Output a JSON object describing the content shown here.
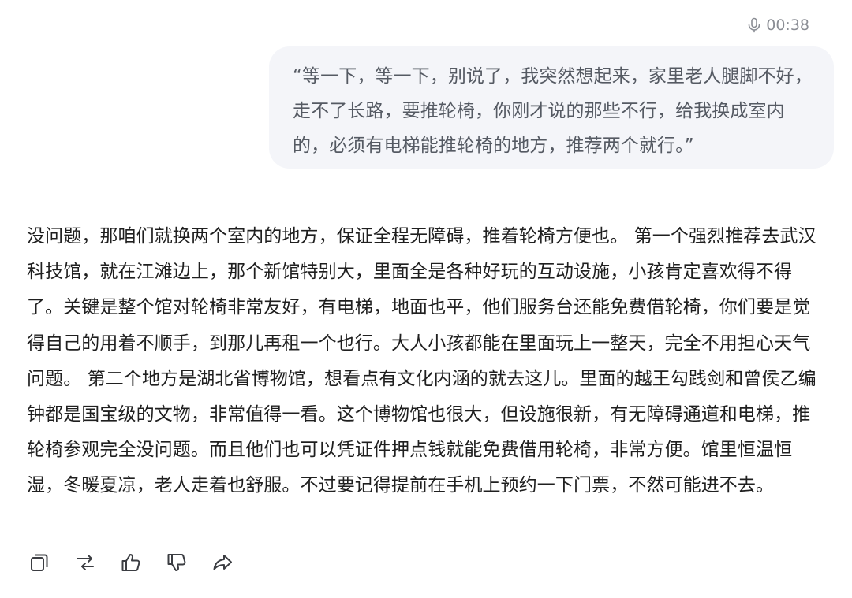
{
  "voice_message": {
    "duration": "00:38",
    "icon": "microphone-icon",
    "text": "“等一下，等一下，别说了，我突然想起来，家里老人腿脚不好，走不了长路，要推轮椅，你刚才说的那些不行，给我换成室内的，必须有电梯能推轮椅的地方，推荐两个就行。”"
  },
  "assistant_reply": {
    "text": "没问题，那咱们就换两个室内的地方，保证全程无障碍，推着轮椅方便也。 第一个强烈推荐去武汉科技馆，就在江滩边上，那个新馆特别大，里面全是各种好玩的互动设施，小孩肯定喜欢得不得了。关键是整个馆对轮椅非常友好，有电梯，地面也平，他们服务台还能免费借轮椅，你们要是觉得自己的用着不顺手，到那儿再租一个也行。大人小孩都能在里面玩上一整天，完全不用担心天气问题。 第二个地方是湖北省博物馆，想看点有文化内涵的就去这儿。里面的越王勾践剑和曾侯乙编钟都是国宝级的文物，非常值得一看。这个博物馆也很大，但设施很新，有无障碍通道和电梯，推轮椅参观完全没问题。而且他们也可以凭证件押点钱就能免费借用轮椅，非常方便。馆里恒温恒湿，冬暖夏凉，老人走着也舒服。不过要记得提前在手机上预约一下门票，不然可能进不去。"
  },
  "action_bar": {
    "icons": [
      "copy-icon",
      "regenerate-icon",
      "thumbs-up-icon",
      "thumbs-down-icon",
      "share-icon"
    ]
  },
  "colors": {
    "bubble_bg": "#f4f5f9",
    "meta_text": "#8a8d94",
    "icon": "#3b3d42"
  }
}
